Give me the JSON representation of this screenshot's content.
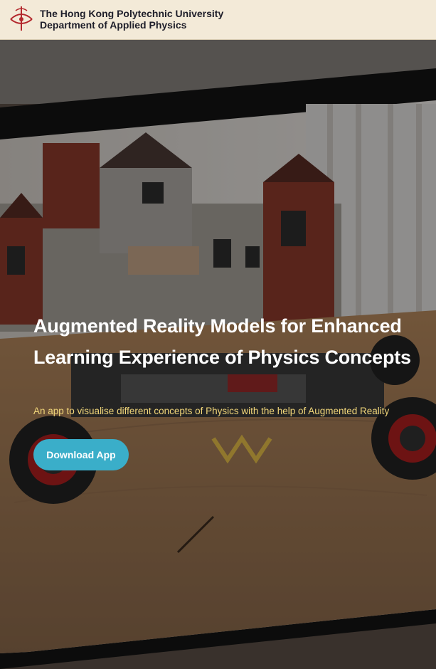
{
  "header": {
    "logo_icon": "polyu-logo-icon",
    "university": "The Hong Kong Polytechnic University",
    "department": "Department of Applied Physics"
  },
  "hero": {
    "background": "photo of a tablet showing a LEGO mansion and car model on a wooden table",
    "title": "Augmented Reality Models for Enhanced Learning Experience of Physics Concepts",
    "subtitle": "An app to visualise different concepts of Physics with the help of Augmented Reality",
    "download_label": "Download App"
  },
  "colors": {
    "header_bg": "#f3ead8",
    "logo_red": "#b3282d",
    "title": "#ffffff",
    "subtitle": "#f2d77a",
    "button_bg": "#3aaec9",
    "button_text": "#ffffff"
  }
}
